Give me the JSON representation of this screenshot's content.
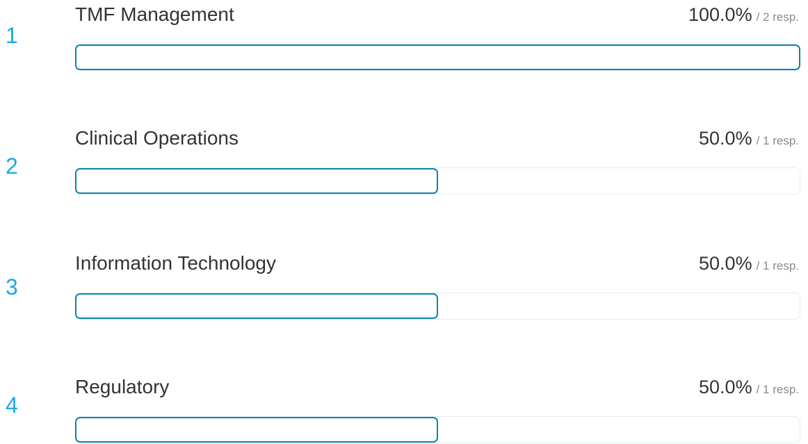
{
  "chart_data": {
    "type": "bar",
    "orientation": "horizontal",
    "unit": "%",
    "xlim": [
      0,
      100
    ],
    "colors": {
      "fill_border": "#0d83ab",
      "track_border": "#dfeef3",
      "rank": "#1aa7e8"
    },
    "rows": [
      {
        "rank": "1",
        "label": "TMF Management",
        "percent_text": "100.0%",
        "responses_text": "/ 2 resp.",
        "value": 100.0
      },
      {
        "rank": "2",
        "label": "Clinical Operations",
        "percent_text": "50.0%",
        "responses_text": "/ 1 resp.",
        "value": 50.0
      },
      {
        "rank": "3",
        "label": "Information Technology",
        "percent_text": "50.0%",
        "responses_text": "/ 1 resp.",
        "value": 50.0
      },
      {
        "rank": "4",
        "label": "Regulatory",
        "percent_text": "50.0%",
        "responses_text": "/ 1 resp.",
        "value": 50.0
      }
    ]
  }
}
